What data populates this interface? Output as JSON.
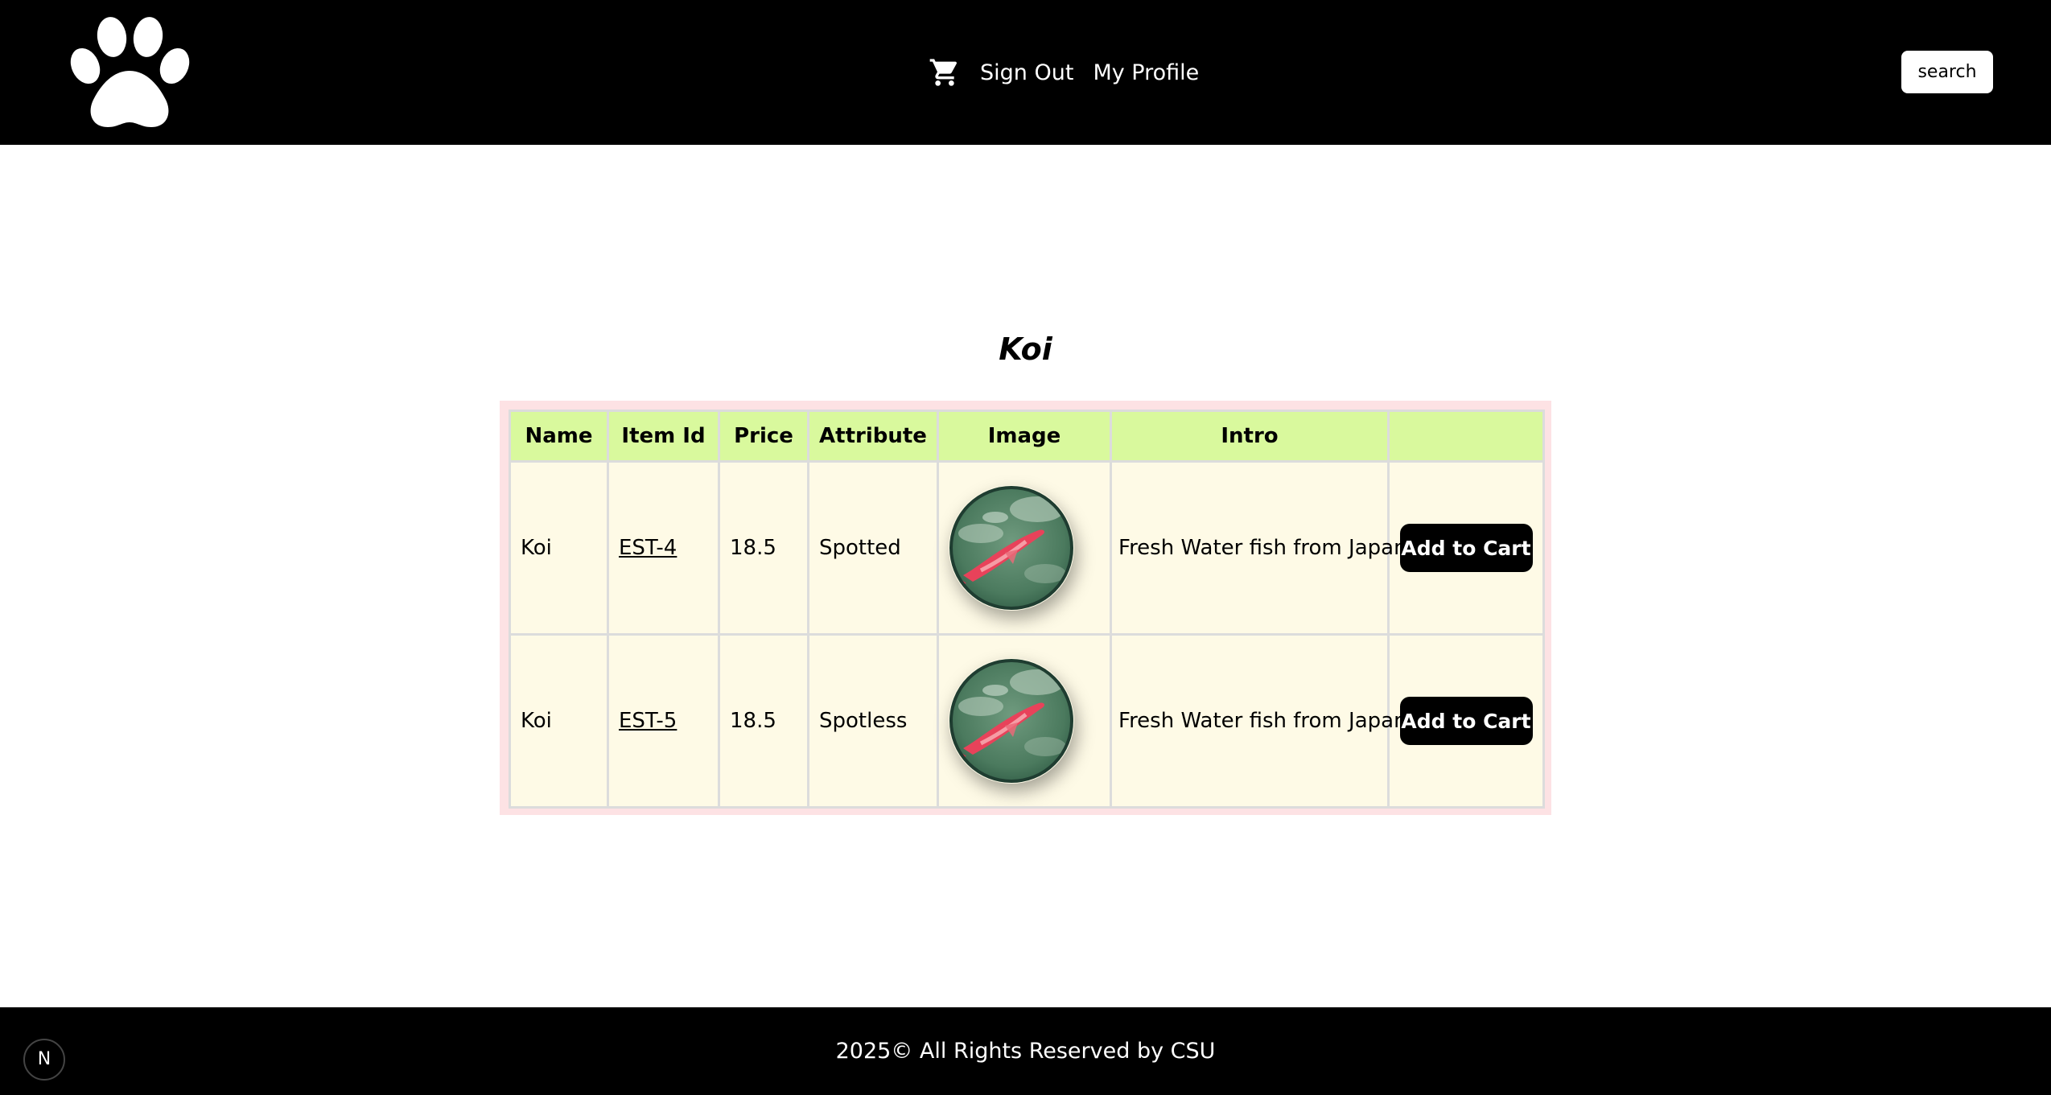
{
  "header": {
    "nav": {
      "cart_icon": "shopping-cart-icon",
      "sign_out_label": "Sign Out",
      "my_profile_label": "My Profile"
    },
    "search_label": "search"
  },
  "main": {
    "title": "Koi",
    "columns": [
      "Name",
      "Item Id",
      "Price",
      "Attribute",
      "Image",
      "Intro",
      ""
    ],
    "rows": [
      {
        "name": "Koi",
        "item_id": "EST-4",
        "price": "18.5",
        "attribute": "Spotted",
        "image": "koi-fish-image",
        "intro": "Fresh Water fish from Japan",
        "button_label": "Add to Cart"
      },
      {
        "name": "Koi",
        "item_id": "EST-5",
        "price": "18.5",
        "attribute": "Spotless",
        "image": "koi-fish-image",
        "intro": "Fresh Water fish from Japan",
        "button_label": "Add to Cart"
      }
    ]
  },
  "footer": {
    "text": "2025© All Rights Reserved by CSU",
    "badge_label": "N"
  },
  "colors": {
    "header_bg": "#000000",
    "table_frame": "#fde2e4",
    "table_header_bg": "#d9f99d",
    "table_cell_bg": "#fefae6",
    "button_bg": "#000000"
  }
}
